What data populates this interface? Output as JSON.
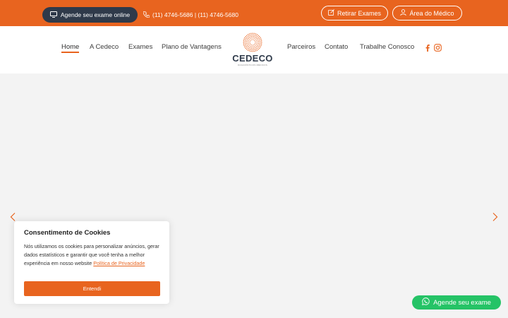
{
  "topbar": {
    "schedule_label": "Agende seu exame online",
    "phones": "(11) 4746-5686 | (11) 4746-5680",
    "results_label": "Retirar Exames",
    "doctor_label": "Área do Médico"
  },
  "nav": {
    "left": [
      "Home",
      "A Cedeco",
      "Exames",
      "Plano de Vantagens"
    ],
    "right": [
      "Parceiros",
      "Contato",
      "Trabalhe Conosco"
    ],
    "active": "Home"
  },
  "logo": {
    "name": "CEDECO",
    "tagline": "DIAGNÓSTICOS MÉDICOS"
  },
  "icons": {
    "schedule": "monitor-icon",
    "phone": "phone-icon",
    "results": "edit-icon",
    "doctor": "user-icon",
    "facebook": "facebook-icon",
    "instagram": "instagram-icon",
    "whatsapp": "whatsapp-icon",
    "prev": "chevron-left-icon",
    "next": "chevron-right-icon"
  },
  "cookie": {
    "title": "Consentimento de Cookies",
    "text": "Nós utilizamos os cookies para personalizar anúncios, gerar dados estatísticos e garantir que você tenha a melhor experiência em nosso website",
    "link": "Política de Privacidade",
    "button": "Entendi"
  },
  "whatsapp": {
    "label": "Agende seu exame"
  },
  "colors": {
    "brand": "#e8641f",
    "dark": "#2f3a4a",
    "whatsapp": "#25c366"
  }
}
